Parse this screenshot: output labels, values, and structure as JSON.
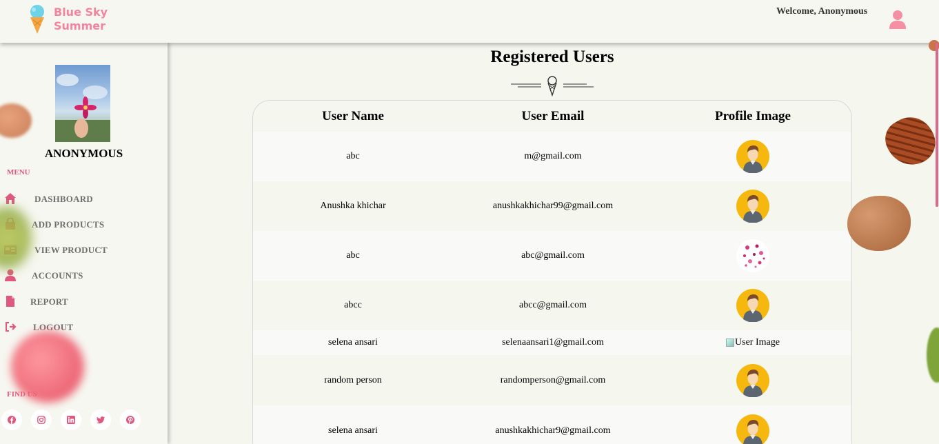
{
  "header": {
    "logo_line1": "Blue Sky",
    "logo_line2": "Summer",
    "welcome": "Welcome, Anonymous"
  },
  "sidebar": {
    "profile_name": "ANONYMOUS",
    "menu_title": "MENU",
    "items": [
      {
        "label": "DASHBOARD",
        "icon": "home-icon"
      },
      {
        "label": "ADD PRODUCTS",
        "icon": "shopping-bag-icon"
      },
      {
        "label": "VIEW PRODUCT",
        "icon": "id-card-icon"
      },
      {
        "label": "ACCOUNTS",
        "icon": "user-icon"
      },
      {
        "label": "REPORT",
        "icon": "file-icon"
      },
      {
        "label": "LOGOUT",
        "icon": "sign-out-icon"
      }
    ],
    "find_us": "FIND US",
    "social": [
      "facebook-icon",
      "instagram-icon",
      "linkedin-icon",
      "twitter-icon",
      "pinterest-icon"
    ]
  },
  "main": {
    "title": "Registered Users",
    "columns": [
      "User Name",
      "User Email",
      "Profile Image"
    ],
    "rows": [
      {
        "name": "abc",
        "email": "m@gmail.com",
        "image": "avatar"
      },
      {
        "name": "Anushka khichar",
        "email": "anushkakhichar99@gmail.com",
        "image": "avatar"
      },
      {
        "name": "abc",
        "email": "abc@gmail.com",
        "image": "floral"
      },
      {
        "name": "abcc",
        "email": "abcc@gmail.com",
        "image": "avatar"
      },
      {
        "name": "selena ansari",
        "email": "selenaansari1@gmail.com",
        "image": "broken",
        "alt": "User Image"
      },
      {
        "name": "random person",
        "email": "randomperson@gmail.com",
        "image": "avatar"
      },
      {
        "name": "selena ansari",
        "email": "anushkakhichar9@gmail.com",
        "image": "avatar"
      }
    ]
  },
  "colors": {
    "accent": "#e0587e",
    "logo": "#f2849e",
    "avatar_bg": "#f6b80f",
    "background": "#f5f7ef"
  }
}
